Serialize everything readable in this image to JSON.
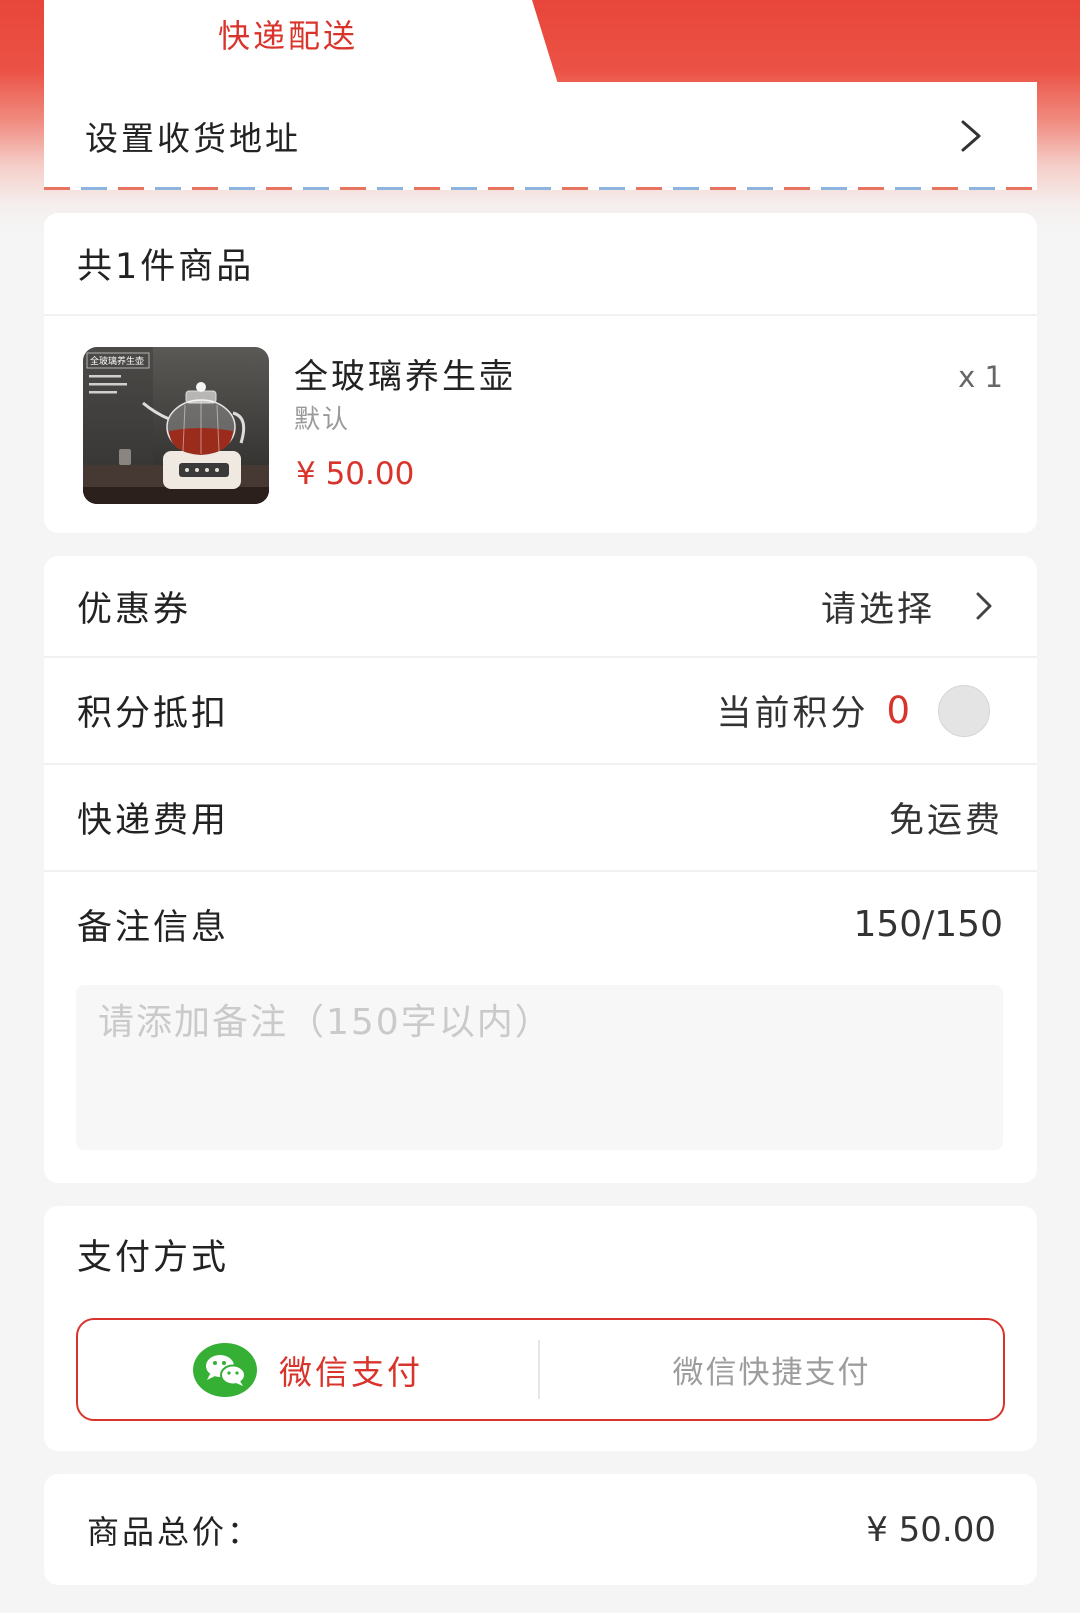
{
  "delivery_tab": {
    "label": "快递配送"
  },
  "address": {
    "label": "设置收货地址",
    "icon": "chevron-right-icon"
  },
  "goods": {
    "header": "共1件商品",
    "item": {
      "title": "全玻璃养生壶",
      "spec": "默认",
      "price": "¥ 50.00",
      "quantity": "x 1",
      "image_caption": "全玻璃养生壶"
    }
  },
  "options": {
    "coupon": {
      "label": "优惠券",
      "value": "请选择",
      "icon": "chevron-right-icon"
    },
    "points": {
      "label": "积分抵扣",
      "current_label": "当前积分",
      "current_value": "0",
      "enabled": false
    },
    "shipping": {
      "label": "快递费用",
      "value": "免运费"
    },
    "remark": {
      "label": "备注信息",
      "counter": "150/150",
      "placeholder": "请添加备注（150字以内）"
    }
  },
  "payment": {
    "title": "支付方式",
    "methods": [
      {
        "label": "微信支付",
        "icon": "wechat-pay-icon",
        "selected": true
      },
      {
        "label": "微信快捷支付",
        "selected": false
      }
    ]
  },
  "total": {
    "label": "商品总价：",
    "value": "¥ 50.00"
  },
  "colors": {
    "accent": "#d9342b",
    "wechat_green": "#35b035",
    "background": "#f5f5f5",
    "header_red": "#e8463a"
  }
}
